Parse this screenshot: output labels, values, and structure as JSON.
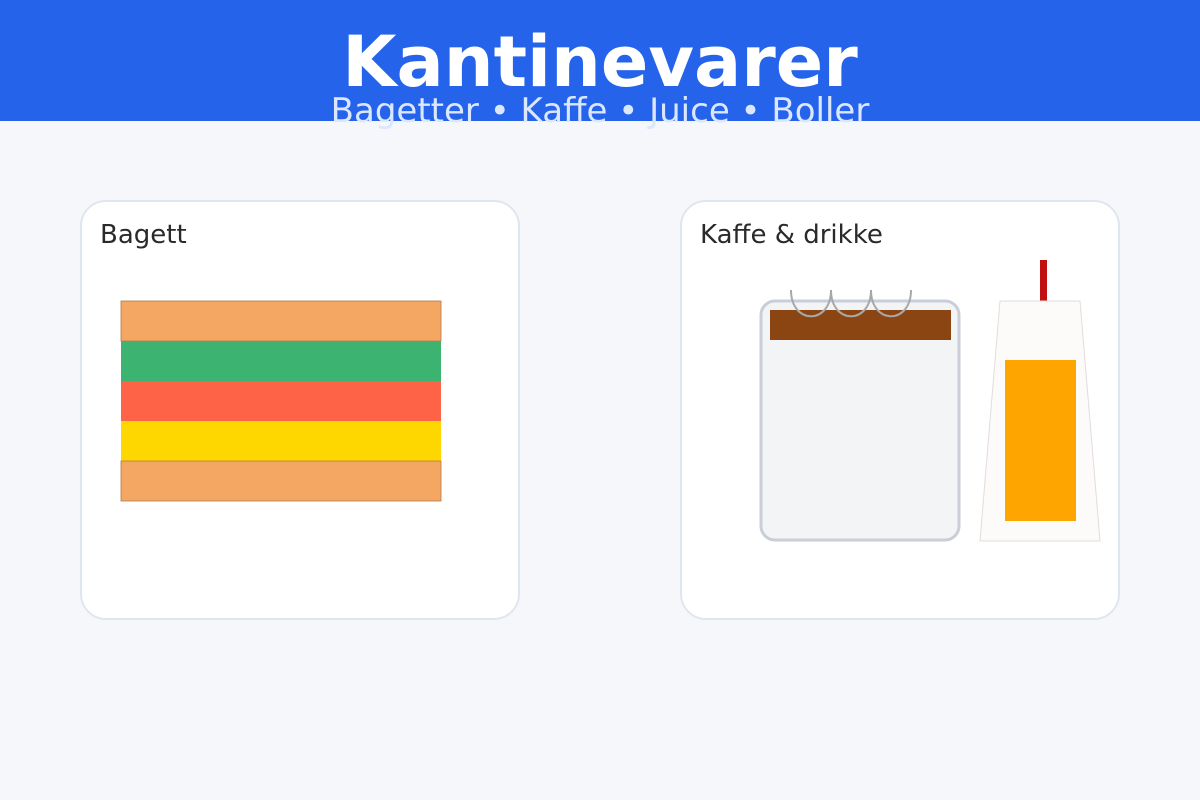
{
  "header": {
    "title": "Kantinevarer",
    "subtitle": "Bagetter • Kaffe • Juice • Boller",
    "background": "#2563eb"
  },
  "cards": {
    "baguette": {
      "label": "Bagett"
    },
    "drinks": {
      "label": "Kaffe & drikke"
    }
  },
  "colors": {
    "bread": "#f4a663",
    "lettuce": "#3cb371",
    "tomato": "#ff6347",
    "cheese": "#ffd700",
    "coffee": "#8b4513",
    "mug": "#f3f4f6",
    "mug_border": "#c9ced8",
    "juice": "#ffa500",
    "straw": "#c01010"
  }
}
